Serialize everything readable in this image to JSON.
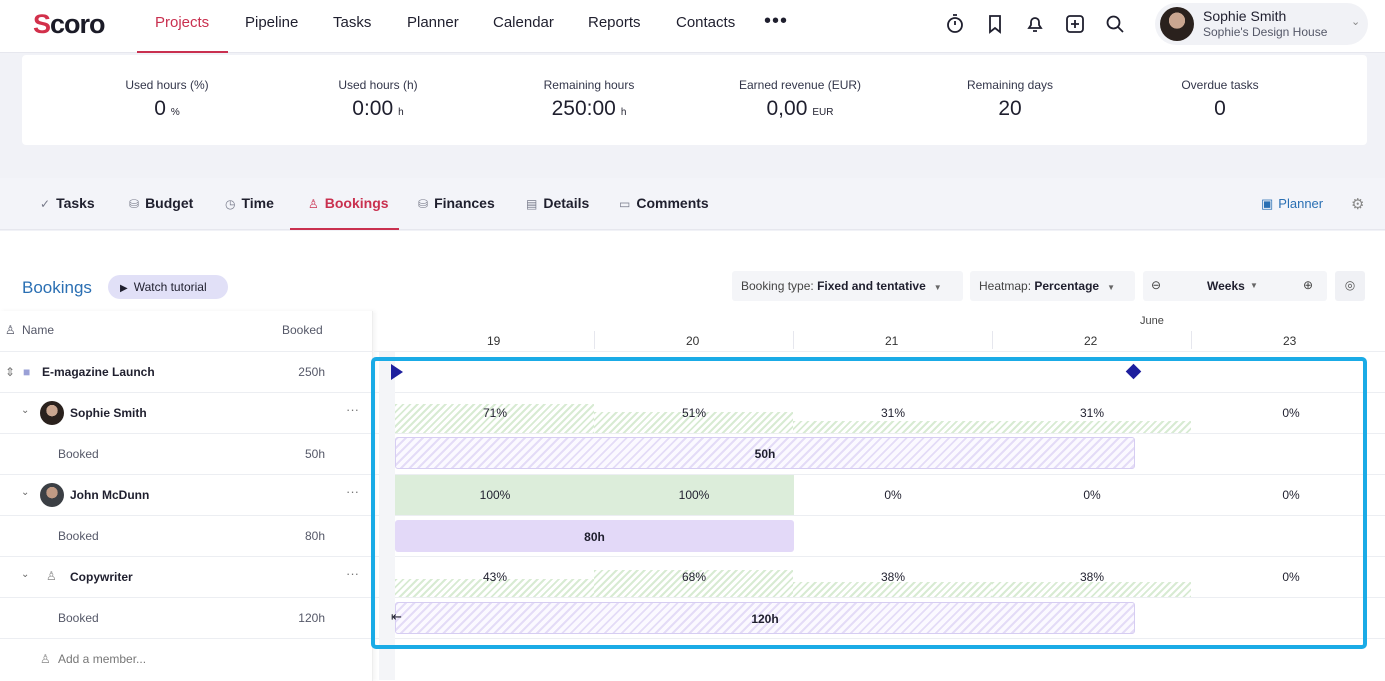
{
  "nav": {
    "logo": "Scoro",
    "items": [
      "Projects",
      "Pipeline",
      "Tasks",
      "Planner",
      "Calendar",
      "Reports",
      "Contacts"
    ],
    "more": "•••"
  },
  "user": {
    "name": "Sophie Smith",
    "company": "Sophie's Design House"
  },
  "stats": [
    {
      "label": "Used hours (%)",
      "value": "0",
      "unit": "%"
    },
    {
      "label": "Used hours (h)",
      "value": "0:00",
      "unit": "h"
    },
    {
      "label": "Remaining hours",
      "value": "250:00",
      "unit": "h"
    },
    {
      "label": "Earned revenue (EUR)",
      "value": "0,00",
      "unit": "EUR"
    },
    {
      "label": "Remaining days",
      "value": "20",
      "unit": ""
    },
    {
      "label": "Overdue tasks",
      "value": "0",
      "unit": ""
    }
  ],
  "tabs": [
    "Tasks",
    "Budget",
    "Time",
    "Bookings",
    "Finances",
    "Details",
    "Comments"
  ],
  "planner_link": "Planner",
  "bookings": {
    "title": "Bookings",
    "tutorial": "Watch tutorial",
    "booking_type_label": "Booking type:",
    "booking_type_value": "Fixed and tentative",
    "heatmap_label": "Heatmap:",
    "heatmap_value": "Percentage",
    "period": "Weeks"
  },
  "table": {
    "col_name": "Name",
    "col_booked": "Booked",
    "add_member": "Add a member...",
    "month": "June",
    "weeks": [
      "19",
      "20",
      "21",
      "22",
      "23"
    ],
    "project": {
      "name": "E-magazine Launch",
      "hours": "250h"
    },
    "members": [
      {
        "name": "Sophie Smith",
        "sub": "Booked",
        "hours": "50h",
        "bar": "50h",
        "pcts": [
          "71%",
          "51%",
          "31%",
          "31%",
          "0%"
        ]
      },
      {
        "name": "John McDunn",
        "sub": "Booked",
        "hours": "80h",
        "bar": "80h",
        "pcts": [
          "100%",
          "100%",
          "0%",
          "0%",
          "0%"
        ]
      },
      {
        "name": "Copywriter",
        "sub": "Booked",
        "hours": "120h",
        "bar": "120h",
        "pcts": [
          "43%",
          "68%",
          "38%",
          "38%",
          "0%"
        ]
      }
    ]
  }
}
